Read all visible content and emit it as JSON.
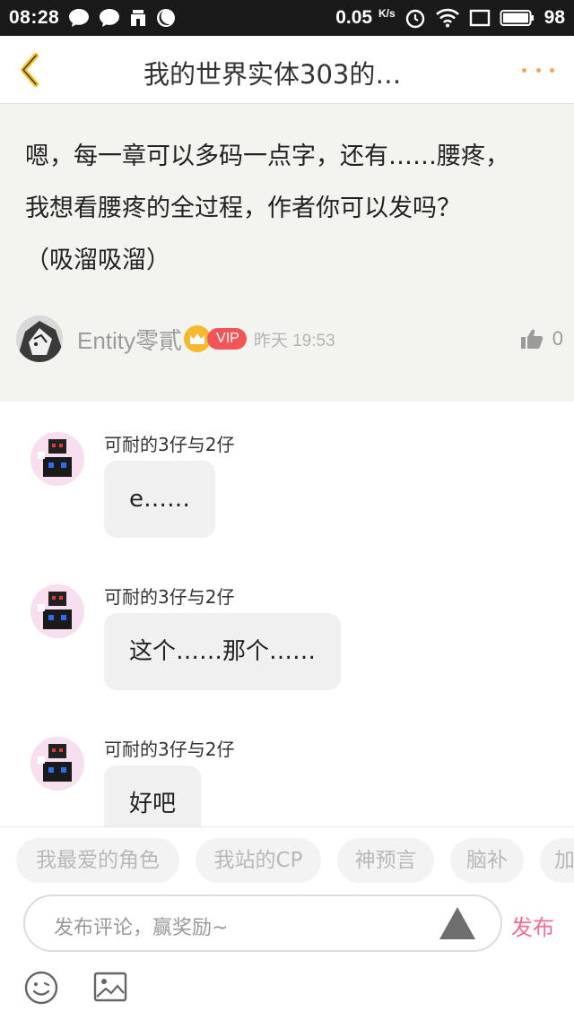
{
  "status_bar": {
    "time": "08:28",
    "net_speed": "0.05",
    "net_unit": "K/s",
    "battery": "98"
  },
  "header": {
    "title": "我的世界实体303的…"
  },
  "original_comment": {
    "text_line1": "嗯，每一章可以多码一点字，还有……腰疼，",
    "text_line2": "我想看腰疼的全过程，作者你可以发吗？",
    "text_line3": "（吸溜吸溜）",
    "author": "Entity零貳",
    "badge": "VIP",
    "time": "昨天 19:53",
    "likes": "0"
  },
  "replies": [
    {
      "name": "可耐的3仔与2仔",
      "text": "e……"
    },
    {
      "name": "可耐的3仔与2仔",
      "text": "这个……那个……"
    },
    {
      "name": "可耐的3仔与2仔",
      "text": "好吧"
    }
  ],
  "tags": [
    "我最爱的角色",
    "我站的CP",
    "神预言",
    "脑补",
    "加"
  ],
  "composer": {
    "placeholder": "发布评论，赢奖励~",
    "publish_label": "发布"
  },
  "colors": {
    "status_bar_bg": "#1a1a1a",
    "accent_orange": "#f0a35e",
    "vip_red": "#f25557",
    "publish_pink": "#ec6f90",
    "comment_bg": "#f3f3ef"
  }
}
